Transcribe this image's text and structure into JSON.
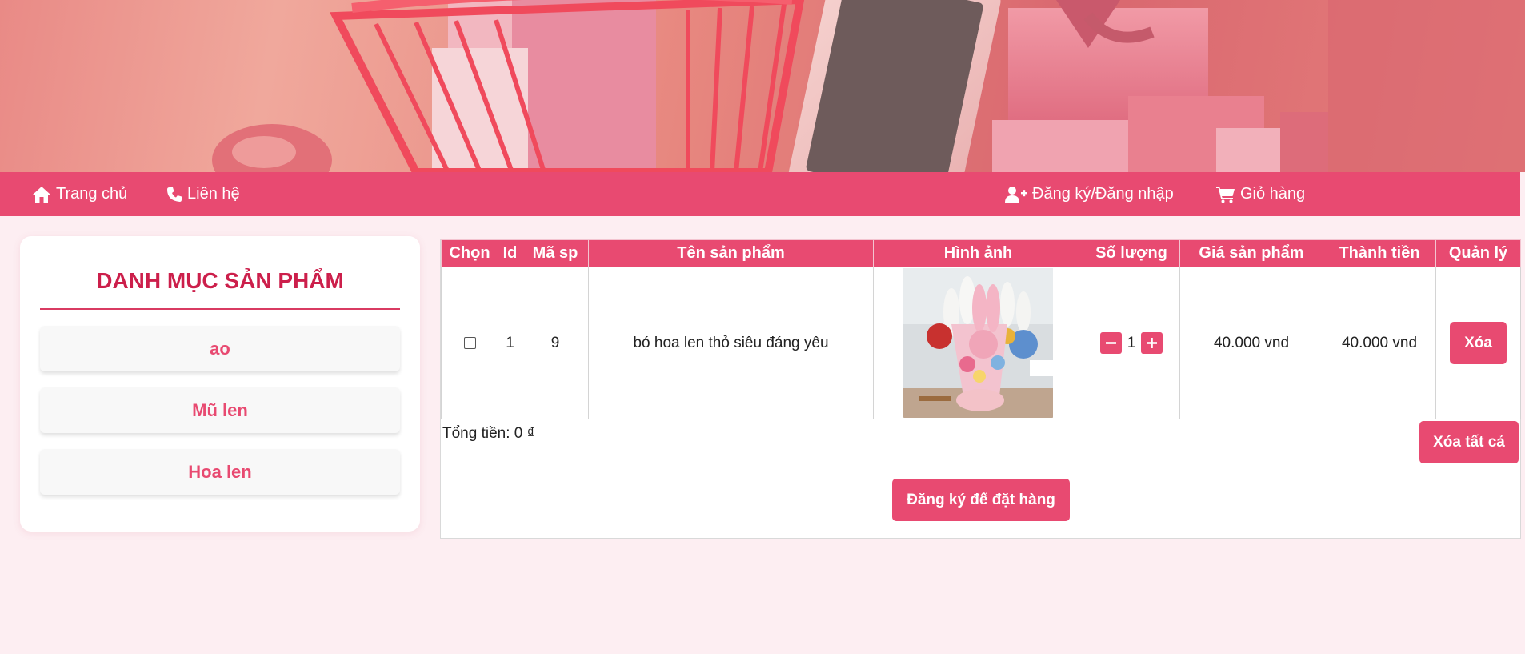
{
  "nav": {
    "home": "Trang chủ",
    "contact": "Liên hệ",
    "login": "Đăng ký/Đăng nhập",
    "cart": "Giỏ hàng"
  },
  "sidebar": {
    "title": "DANH MỤC SẢN PHẨM",
    "items": [
      {
        "label": "ao"
      },
      {
        "label": "Mũ len"
      },
      {
        "label": "Hoa len"
      }
    ]
  },
  "cart": {
    "headers": [
      "Chọn",
      "Id",
      "Mã sp",
      "Tên sản phẩm",
      "Hình ảnh",
      "Số lượng",
      "Giá sản phẩm",
      "Thành tiền",
      "Quản lý"
    ],
    "rows": [
      {
        "id": "1",
        "code": "9",
        "name": "bó hoa len thỏ siêu đáng yêu",
        "quantity": "1",
        "price": "40.000 vnd",
        "subtotal": "40.000 vnd",
        "delete_label": "Xóa"
      }
    ],
    "total": "Tổng tiền: 0 ₫",
    "clear_all_label": "Xóa tất cả",
    "order_label": "Đăng ký để đặt hàng"
  },
  "colors": {
    "accent": "#e84a71",
    "title": "#cc1f4b",
    "background": "#fdeef2"
  },
  "icons": [
    "home-icon",
    "phone-icon",
    "user-plus-icon",
    "cart-icon",
    "minus-icon",
    "plus-icon"
  ]
}
